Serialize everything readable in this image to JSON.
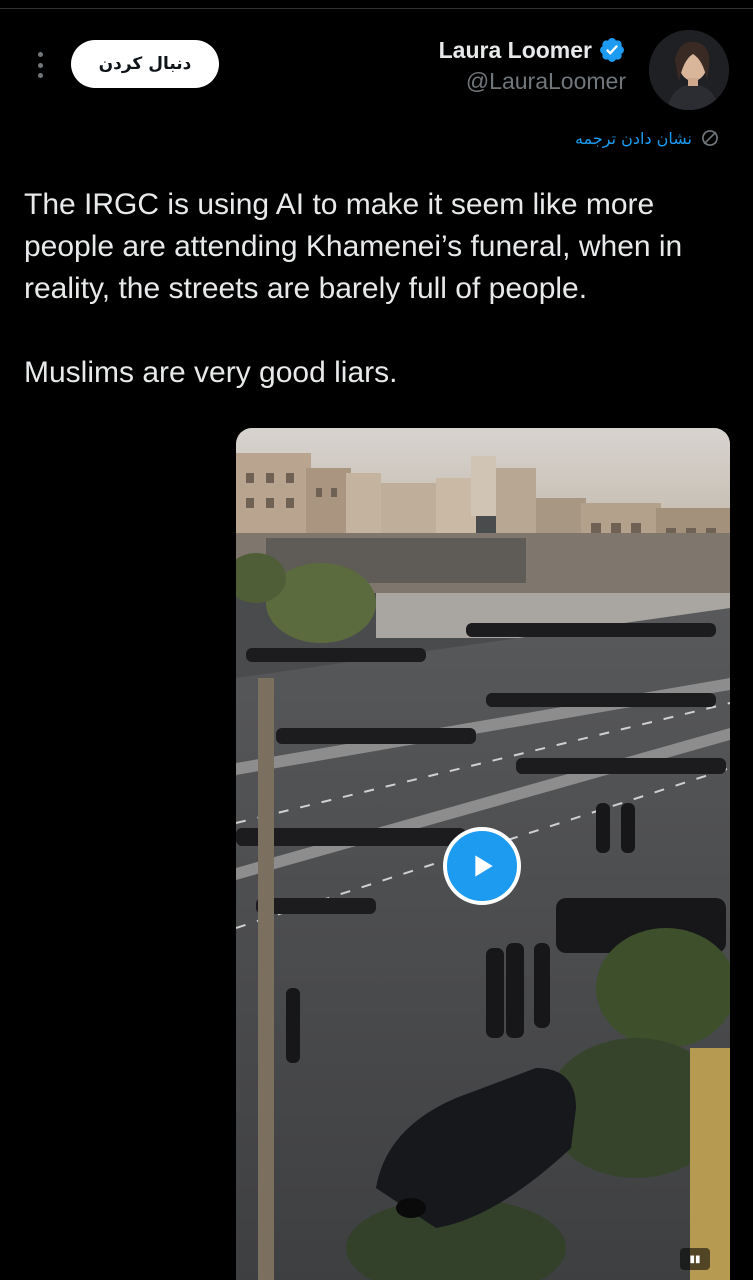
{
  "header": {
    "follow_label": "دنبال کردن",
    "author_name": "Laura Loomer",
    "author_handle": "@LauraLoomer",
    "verified": true
  },
  "translate": {
    "label": "نشان دادن ترجمه"
  },
  "tweet": {
    "paragraphs": [
      "The IRGC is using AI to make it seem like more people are attending Khamenei’s funeral, when in reality, the streets are barely full of people.",
      "Muslims are very good liars."
    ]
  },
  "media": {
    "type": "video",
    "description_icon": "play-icon"
  },
  "colors": {
    "background": "#000000",
    "text": "#e7e9ea",
    "secondary_text": "#71767b",
    "accent": "#1d9bf0",
    "follow_bg": "#ffffff"
  }
}
